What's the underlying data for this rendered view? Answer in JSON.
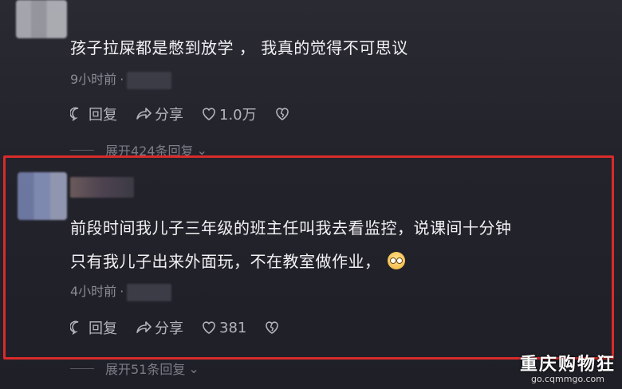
{
  "comment_1": {
    "text": "孩子拉屎都是憋到放学 ， 我真的觉得不可思议",
    "time": "9小时前",
    "dot": "·",
    "reply_label": "回复",
    "share_label": "分享",
    "like_count": "1.0万",
    "expand_label": "展开424条回复"
  },
  "comment_2": {
    "text_line1": "前段时间我儿子三年级的班主任叫我去看监控，说课间十分钟",
    "text_line2": "只有我儿子出来外面玩，不在教室做作业，",
    "time": "4小时前",
    "dot": "·",
    "reply_label": "回复",
    "share_label": "分享",
    "like_count": "381",
    "expand_label": "展开51条回复"
  },
  "watermark": {
    "name": "重庆购物狂",
    "url": "go.cqmmgo.com"
  },
  "colors": {
    "highlight_border": "#d92b2b",
    "background": "#23232b",
    "text": "#f2f2f5",
    "meta": "#8b8b96"
  }
}
